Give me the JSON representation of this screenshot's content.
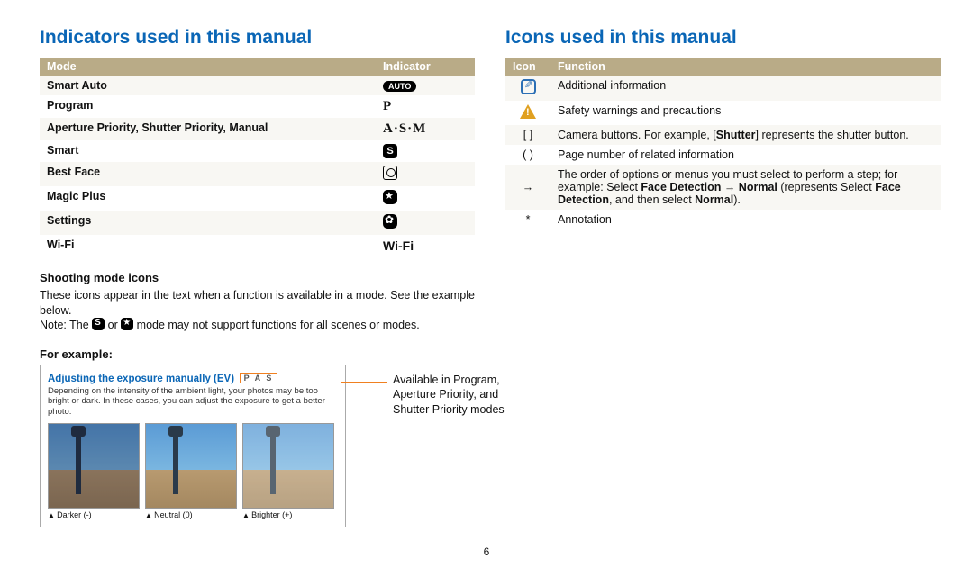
{
  "left": {
    "heading": "Indicators used in this manual",
    "table": {
      "col1": "Mode",
      "col2": "Indicator",
      "rows": [
        {
          "mode": "Smart Auto",
          "indicator_type": "auto",
          "indicator_text": "AUTO"
        },
        {
          "mode": "Program",
          "indicator_type": "pm",
          "indicator_text": "P"
        },
        {
          "mode": "Aperture Priority, Shutter Priority, Manual",
          "indicator_type": "pm",
          "indicator_text": "A·S·M"
        },
        {
          "mode": "Smart",
          "indicator_type": "s",
          "indicator_text": "S"
        },
        {
          "mode": "Best Face",
          "indicator_type": "face",
          "indicator_text": ""
        },
        {
          "mode": "Magic Plus",
          "indicator_type": "star",
          "indicator_text": ""
        },
        {
          "mode": "Settings",
          "indicator_type": "gear",
          "indicator_text": ""
        },
        {
          "mode": "Wi-Fi",
          "indicator_type": "wifi",
          "indicator_text": "Wi-Fi"
        }
      ]
    },
    "shooting_heading": "Shooting mode icons",
    "shooting_body_1": "These icons appear in the text when a function is available in a mode. See the example below.",
    "shooting_note_pre": "Note: The ",
    "shooting_note_mid": " or ",
    "shooting_note_post": " mode may not support functions for all scenes or modes.",
    "for_example_heading": "For example:",
    "example": {
      "title": "Adjusting the exposure manually (EV)",
      "mode_badge": "P A S",
      "desc": "Depending on the intensity of the ambient light, your photos may be too bright or dark. In these cases, you can adjust the exposure to get a better photo.",
      "thumbs": [
        {
          "label": "Darker (-)",
          "tone": "dark"
        },
        {
          "label": "Neutral (0)",
          "tone": ""
        },
        {
          "label": "Brighter (+)",
          "tone": "bright"
        }
      ]
    },
    "callout": "Available in Program, Aperture Priority, and Shutter Priority modes"
  },
  "right": {
    "heading": "Icons used in this manual",
    "table": {
      "col1": "Icon",
      "col2": "Function",
      "rows": [
        {
          "icon": "info",
          "text": "Additional information"
        },
        {
          "icon": "warn",
          "text": "Safety warnings and precautions"
        },
        {
          "icon": "brackets",
          "icon_text": "[  ]",
          "rich": {
            "pre": "Camera buttons. For example, [",
            "bold1": "Shutter",
            "post": "] represents the shutter button."
          }
        },
        {
          "icon": "parens",
          "icon_text": "(  )",
          "text": "Page number of related information"
        },
        {
          "icon": "arrow",
          "icon_text": "→",
          "rich2": {
            "a": "The order of options or menus you must select to perform a step; for example: Select ",
            "b": "Face Detection",
            "c": " → ",
            "d": "Normal",
            "e": " (represents Select ",
            "f": "Face Detection",
            "g": ", and then select ",
            "h": "Normal",
            "i": ")."
          }
        },
        {
          "icon": "asterisk",
          "icon_text": "*",
          "text": "Annotation"
        }
      ]
    }
  },
  "page_number": "6"
}
